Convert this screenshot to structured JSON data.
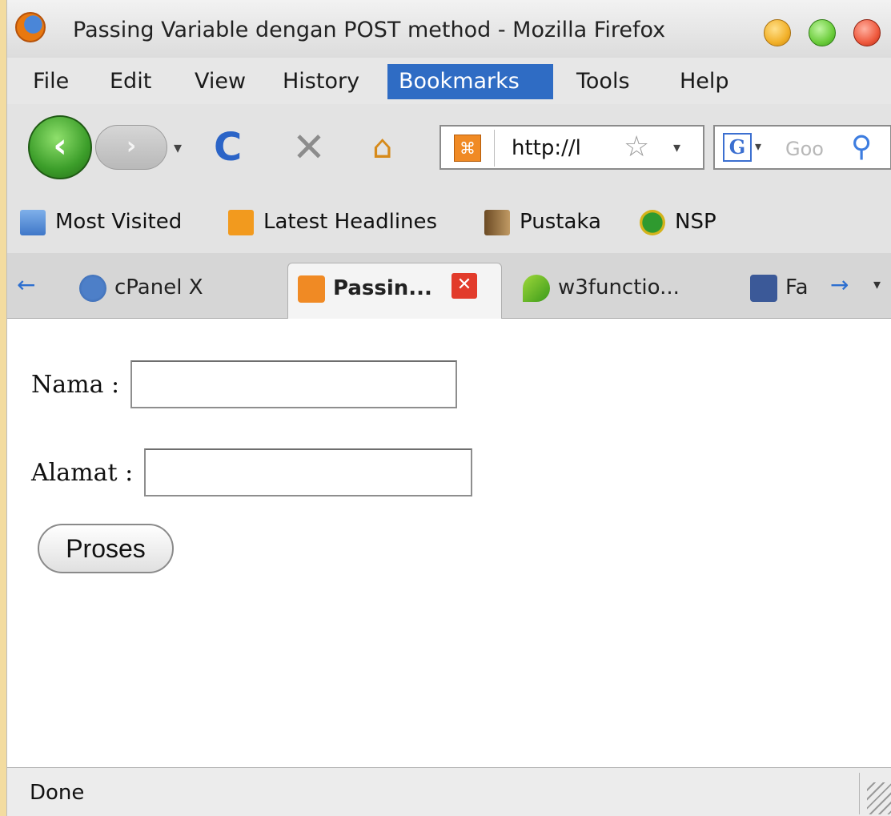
{
  "window": {
    "title": "Passing Variable dengan POST method - Mozilla Firefox",
    "icon": "firefox-logo-icon"
  },
  "menu": {
    "items": [
      "File",
      "Edit",
      "View",
      "History",
      "Bookmarks",
      "Tools",
      "Help"
    ],
    "active": "Bookmarks"
  },
  "nav": {
    "back_glyph": "‹",
    "forward_glyph": "›",
    "reload_glyph": "C",
    "stop_glyph": "✕",
    "home_glyph": "⌂",
    "url": "http://l",
    "star_glyph": "☆",
    "search_engine_glyph": "G",
    "search_placeholder": "Goo",
    "search_glyph": "⚲",
    "dropdown_glyph": "▾"
  },
  "bookmarks": [
    "Most Visited",
    "Latest Headlines",
    "Pustaka",
    "NSP"
  ],
  "tabs": {
    "left_arrow_glyph": "←",
    "right_arrow_glyph": "→",
    "list_glyph": "▾",
    "items": [
      {
        "label": "cPanel X",
        "icon": "cpanel-icon"
      },
      {
        "label": "Passin...",
        "icon": "xampp-icon",
        "active": true
      },
      {
        "label": "w3functio...",
        "icon": "w3functions-icon"
      },
      {
        "label": "Fa",
        "icon": "facebook-icon"
      }
    ],
    "close_glyph": "✕",
    "site_icon_glyph": "⌘",
    "facebook_glyph": "f"
  },
  "form": {
    "nama_label": "Nama :",
    "nama_value": "",
    "alamat_label": "Alamat :",
    "alamat_value": "",
    "submit_label": "Proses"
  },
  "status": {
    "text": "Done"
  },
  "colors": {
    "active_menu": "#2f6cc4",
    "background_border": "#f3dca0"
  }
}
